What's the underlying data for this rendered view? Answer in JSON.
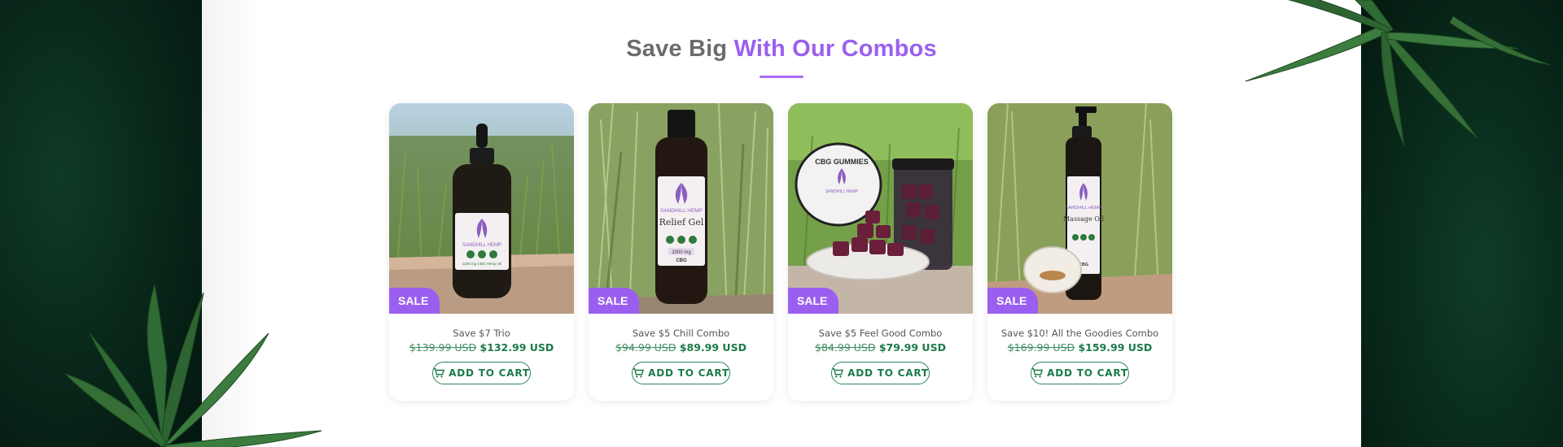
{
  "section": {
    "heading_part1": "Save Big",
    "heading_part2": "With Our Combos",
    "accent_color": "#9b5ff0"
  },
  "products": [
    {
      "sale_badge": "SALE",
      "title": "Save $7 Trio",
      "old_price": "$139.99 USD",
      "new_price": "$132.99 USD",
      "button_label": "ADD TO CART",
      "label_brand": "SANDHILL HEMP",
      "label_detail": "1200 mg CBG Hemp Oil"
    },
    {
      "sale_badge": "SALE",
      "title": "Save $5 Chill Combo",
      "old_price": "$94.99 USD",
      "new_price": "$89.99 USD",
      "button_label": "ADD TO CART",
      "label_brand": "SANDHILL HEMP",
      "label_product": "Relief Gel",
      "label_strength": "2000 mg",
      "label_type": "CBG"
    },
    {
      "sale_badge": "SALE",
      "title": "Save $5 Feel Good Combo",
      "old_price": "$84.99 USD",
      "new_price": "$79.99 USD",
      "button_label": "ADD TO CART",
      "label_product": "CBG GUMMIES",
      "label_brand": "SANDHILL HEMP"
    },
    {
      "sale_badge": "SALE",
      "title": "Save $10! All the Goodies Combo",
      "old_price": "$169.99 USD",
      "new_price": "$159.99 USD",
      "button_label": "ADD TO CART",
      "label_brand": "SANDHILL HEMP",
      "label_product": "Massage Oil",
      "label_type": "CBG"
    }
  ]
}
